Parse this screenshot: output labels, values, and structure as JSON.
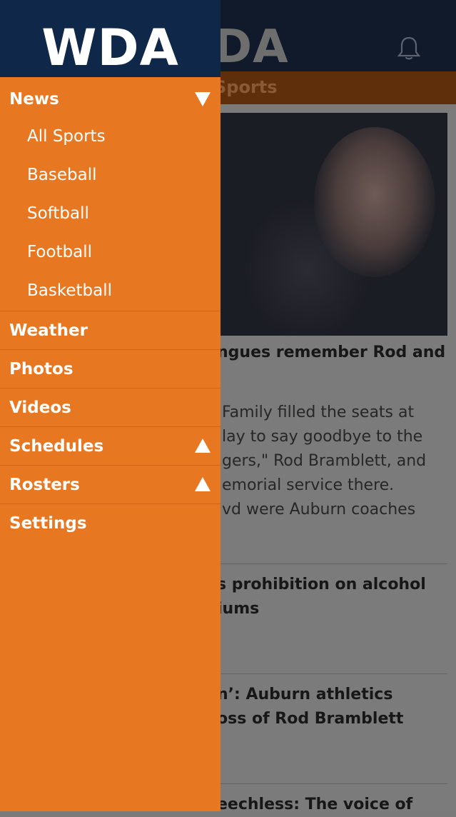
{
  "background": {
    "logo": "DA",
    "tab_label": "Sports",
    "articles": [
      {
        "title": "ngues remember Rod and",
        "snippet": [
          "Family filled the seats at",
          "lay to say goodbye to the",
          "gers,\" Rod Bramblett, and",
          "emorial service there.",
          "vd were Auburn coaches"
        ]
      },
      {
        "title": [
          "s prohibition on alcohol",
          "iums"
        ]
      },
      {
        "title": [
          "n’: Auburn athletics",
          "oss of Rod Bramblett"
        ]
      },
      {
        "title": "eechless: The voice of"
      }
    ]
  },
  "drawer": {
    "logo": "WDA",
    "sections": [
      {
        "label": "News",
        "expanded": true,
        "children": [
          "All Sports",
          "Baseball",
          "Softball",
          "Football",
          "Basketball"
        ]
      },
      {
        "label": "Weather"
      },
      {
        "label": "Photos"
      },
      {
        "label": "Videos"
      },
      {
        "label": "Schedules",
        "expanded": false
      },
      {
        "label": "Rosters",
        "expanded": false
      },
      {
        "label": "Settings"
      }
    ]
  },
  "colors": {
    "drawer_bg": "#e87721",
    "header_bg": "#0f2748"
  },
  "icons": [
    "bell-icon",
    "collapse-triangle-icon",
    "expand-triangle-icon"
  ]
}
